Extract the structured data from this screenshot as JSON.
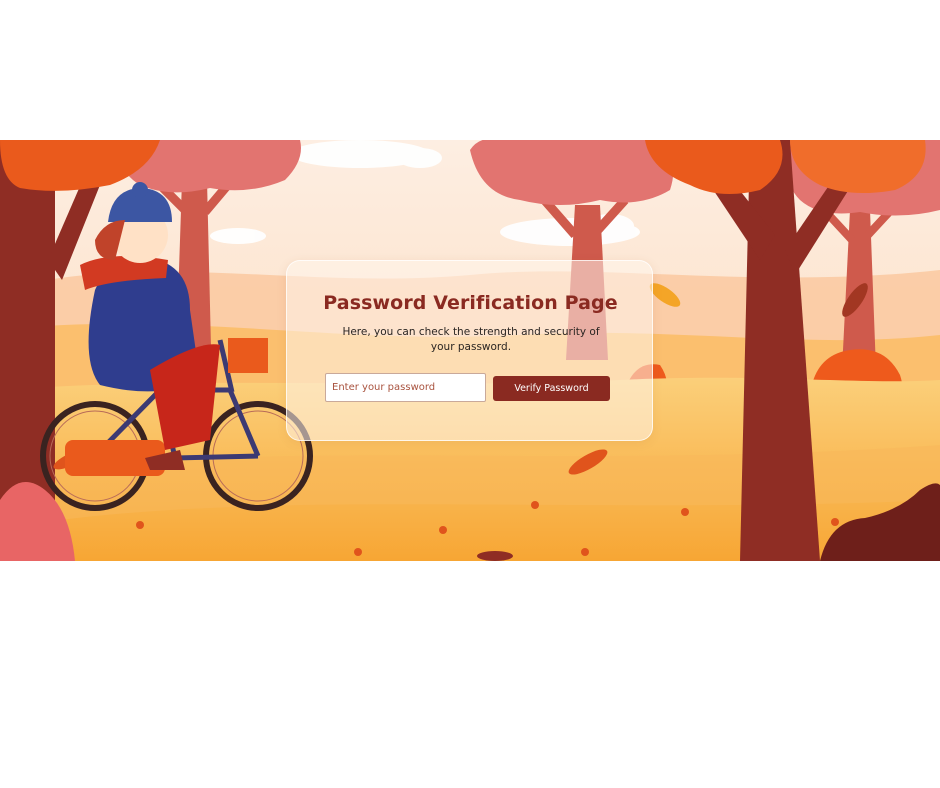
{
  "card": {
    "title": "Password Verification Page",
    "description": "Here, you can check the strength and security of your password.",
    "input": {
      "value": "",
      "placeholder": "Enter your password"
    },
    "verify_button_label": "Verify Password"
  },
  "colors": {
    "accent": "#8a2a21",
    "sky": "#fde7d3",
    "ground": "#f6a23a",
    "tree_trunk": "#8f2d24",
    "foliage_orange": "#ea5a1c",
    "foliage_pink": "#e36f6a"
  }
}
